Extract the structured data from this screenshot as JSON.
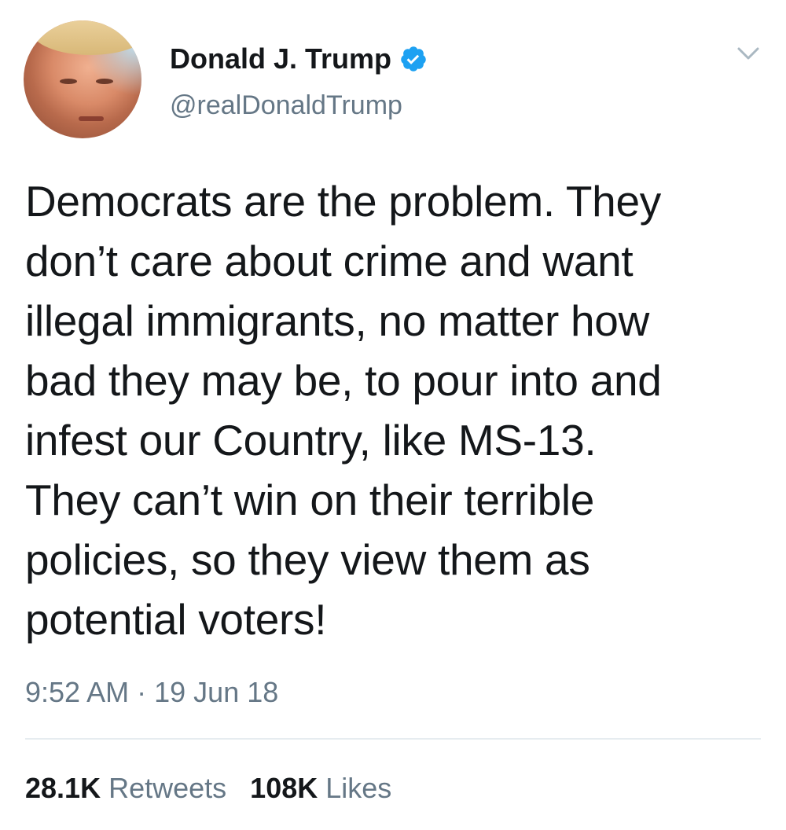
{
  "author": {
    "display_name": "Donald J. Trump",
    "handle": "@realDonaldTrump",
    "verified": true,
    "verified_color": "#1da1f2"
  },
  "tweet": {
    "lines": [
      "Democrats are the problem. They",
      "don’t care about crime and want",
      "illegal immigrants, no matter how",
      "bad they may be, to pour into and",
      "infest our Country, like MS-13.",
      "They can’t win on their terrible",
      "policies, so they view them as",
      "potential voters!"
    ],
    "time": "9:52 AM",
    "separator": "·",
    "date": "19 Jun 18"
  },
  "stats": {
    "retweets_count": "28.1K",
    "retweets_label": "Retweets",
    "likes_count": "108K",
    "likes_label": "Likes"
  },
  "icons": {
    "verified": "verified-badge-icon",
    "menu": "chevron-down-icon"
  }
}
